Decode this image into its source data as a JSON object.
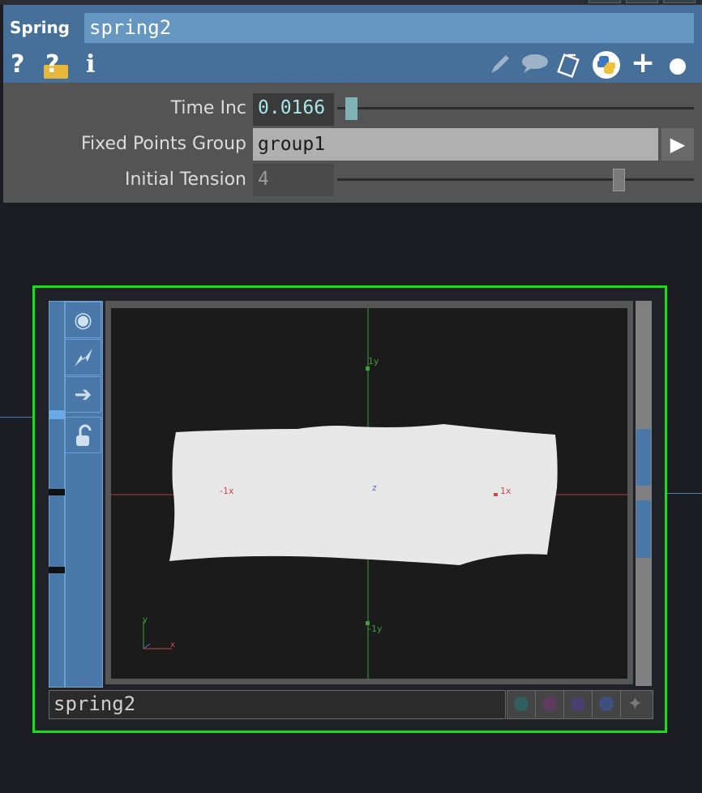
{
  "operator": {
    "type": "Spring",
    "name": "spring2"
  },
  "header_icons": {
    "help": "?",
    "python_help": "?",
    "info": "i",
    "edit": "pencil-icon",
    "comment": "comment-icon",
    "clone": "clone-icon",
    "python": "python-icon",
    "add": "+",
    "bypass": "dot-icon"
  },
  "params": {
    "time_inc": {
      "label": "Time Inc",
      "value": "0.0166",
      "slider": 0.0
    },
    "fixed_points_group": {
      "label": "Fixed Points Group",
      "value": "group1",
      "menu_glyph": "▶"
    },
    "initial_tension": {
      "label": "Initial Tension",
      "value": "4",
      "slider": 0.8
    }
  },
  "viewer": {
    "axis_labels": {
      "pos_y": "1y",
      "neg_y": "-1y",
      "pos_x": "1x",
      "neg_x": "-1x",
      "z": "z"
    },
    "gizmo": {
      "y": "y",
      "x": "x"
    },
    "footer_name": "spring2"
  },
  "colors": {
    "header_bg": "#46709a",
    "name_field_bg": "#6696c2",
    "active_border": "#18e018",
    "time_inc_text": "#a9e6ea",
    "x_axis": "#c84a4a",
    "y_axis": "#3aa03a",
    "z_axis": "#6b6bd8"
  }
}
